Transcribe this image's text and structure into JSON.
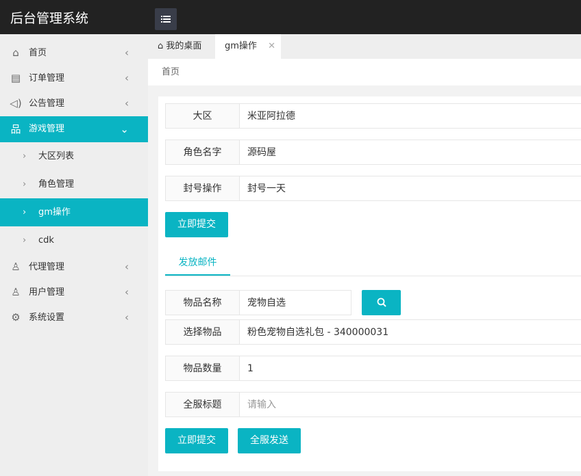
{
  "app": {
    "title": "后台管理系统"
  },
  "sidebar": {
    "items": [
      {
        "label": "首页",
        "icon": "home-icon"
      },
      {
        "label": "订单管理",
        "icon": "document-icon"
      },
      {
        "label": "公告管理",
        "icon": "speaker-icon"
      },
      {
        "label": "游戏管理",
        "icon": "sitemap-icon"
      },
      {
        "label": "代理管理",
        "icon": "group-icon"
      },
      {
        "label": "用户管理",
        "icon": "user-icon"
      },
      {
        "label": "系统设置",
        "icon": "gear-icon"
      }
    ],
    "subitems": [
      "大区列表",
      "角色管理",
      "gm操作",
      "cdk"
    ]
  },
  "tabs": {
    "home": "我的桌面",
    "current": "gm操作"
  },
  "breadcrumb": "首页",
  "form": {
    "region_label": "大区",
    "region_value": "米亚阿拉德",
    "role_label": "角色名字",
    "role_value": "源码屋",
    "ban_label": "封号操作",
    "ban_value": "封号一天",
    "submit1": "立即提交"
  },
  "mail": {
    "tab": "发放邮件",
    "item_name_label": "物品名称",
    "item_name_value": "宠物自选",
    "select_label": "选择物品",
    "select_value": "粉色宠物自选礼包 - 340000031",
    "qty_label": "物品数量",
    "qty_value": "1",
    "title_label": "全服标题",
    "title_placeholder": "请输入",
    "submit": "立即提交",
    "send_all": "全服发送"
  },
  "colors": {
    "accent": "#0ab4c3",
    "header": "#222222"
  }
}
